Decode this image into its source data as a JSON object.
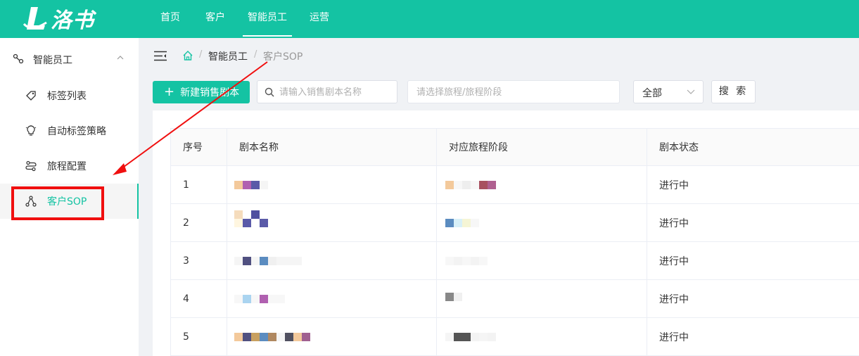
{
  "app": {
    "brand_text": "洛书"
  },
  "topnav": {
    "items": [
      {
        "label": "首页"
      },
      {
        "label": "客户"
      },
      {
        "label": "智能员工",
        "active": true
      },
      {
        "label": "运营"
      }
    ]
  },
  "sidebar": {
    "group_label": "智能员工",
    "items": [
      {
        "label": "标签列表",
        "icon": "tag-icon"
      },
      {
        "label": "自动标签策略",
        "icon": "bulb-icon"
      },
      {
        "label": "旅程配置",
        "icon": "route-icon"
      },
      {
        "label": "客户SOP",
        "icon": "org-icon",
        "active": true
      }
    ]
  },
  "breadcrumb": {
    "separator": "/",
    "items": [
      "智能员工",
      "客户SOP"
    ]
  },
  "toolbar": {
    "new_button_label": "新建销售剧本",
    "search_placeholder": "请输入销售剧本名称",
    "journey_placeholder": "请选择旅程/旅程阶段",
    "status_value": "全部",
    "search_button_label": "搜 索"
  },
  "table": {
    "columns": [
      "序号",
      "剧本名称",
      "对应旅程阶段",
      "剧本状态"
    ],
    "rows": [
      {
        "index": "1",
        "status": "进行中"
      },
      {
        "index": "2",
        "status": "进行中"
      },
      {
        "index": "3",
        "status": "进行中"
      },
      {
        "index": "4",
        "status": "进行中"
      },
      {
        "index": "5",
        "status": "进行中"
      }
    ]
  },
  "colors": {
    "brand": "#14c3a3",
    "annotation_red": "#f00f0f"
  }
}
